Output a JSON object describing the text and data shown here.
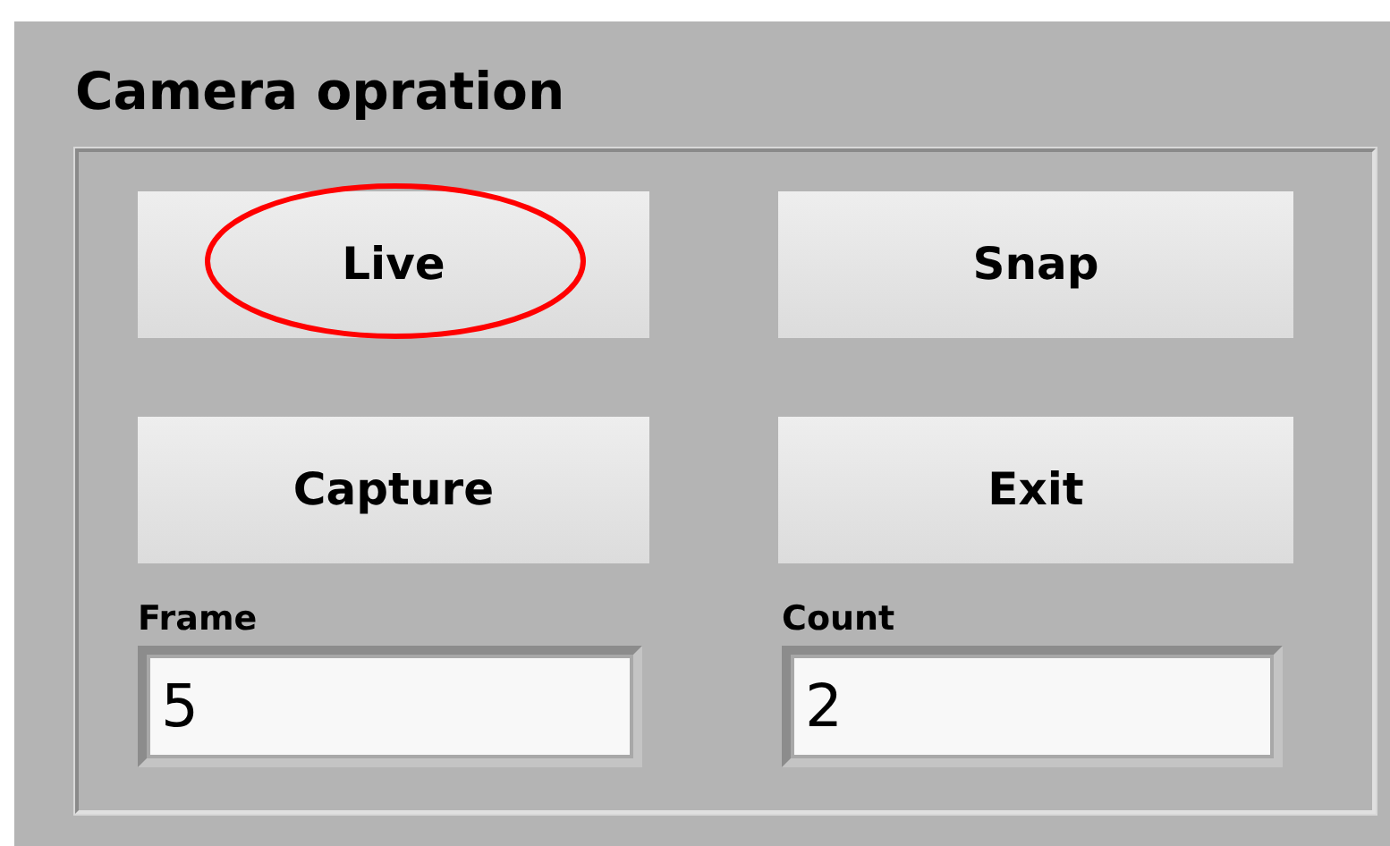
{
  "group": {
    "title": "Camera opration"
  },
  "buttons": [
    {
      "label": "Live",
      "highlighted": true
    },
    {
      "label": "Snap",
      "highlighted": false
    },
    {
      "label": "Capture",
      "highlighted": false
    },
    {
      "label": "Exit",
      "highlighted": false
    }
  ],
  "fields": [
    {
      "label": "Frame",
      "value": "5"
    },
    {
      "label": "Count",
      "value": "2"
    }
  ]
}
